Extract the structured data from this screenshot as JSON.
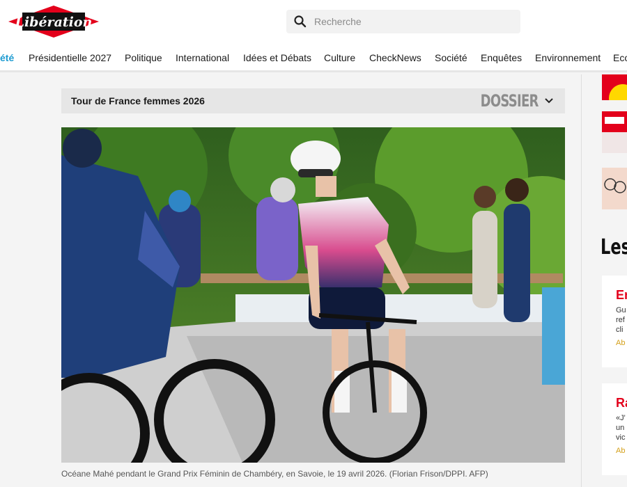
{
  "header": {
    "logo_text": "Libération",
    "search": {
      "placeholder": "Recherche",
      "value": ""
    }
  },
  "nav": {
    "items": [
      {
        "label": "été",
        "active": true
      },
      {
        "label": "Présidentielle 2027"
      },
      {
        "label": "Politique"
      },
      {
        "label": "International"
      },
      {
        "label": "Idées et Débats"
      },
      {
        "label": "Culture"
      },
      {
        "label": "CheckNews"
      },
      {
        "label": "Société"
      },
      {
        "label": "Enquêtes"
      },
      {
        "label": "Environnement"
      },
      {
        "label": "Eco"
      }
    ]
  },
  "dossier": {
    "title": "Tour de France femmes 2026",
    "label": "DOSSIER"
  },
  "article": {
    "caption": "Océane Mahé pendant le Grand Prix Féminin de Chambéry, en Savoie, le 19 avril 2026. (Florian Frison/DPPI. AFP)"
  },
  "sidebar": {
    "section_title": "Les",
    "cards": [
      {
        "title": "En",
        "lines": [
          "Gu",
          "ref",
          "cli"
        ],
        "link": "Ab"
      },
      {
        "title": "Ra",
        "lines": [
          "«J'",
          "un",
          "vic"
        ],
        "link": "Ab"
      }
    ]
  },
  "colors": {
    "accent_blue": "#1d9bd1",
    "brand_red": "#e3001b",
    "link_gold": "#d4a01a"
  }
}
